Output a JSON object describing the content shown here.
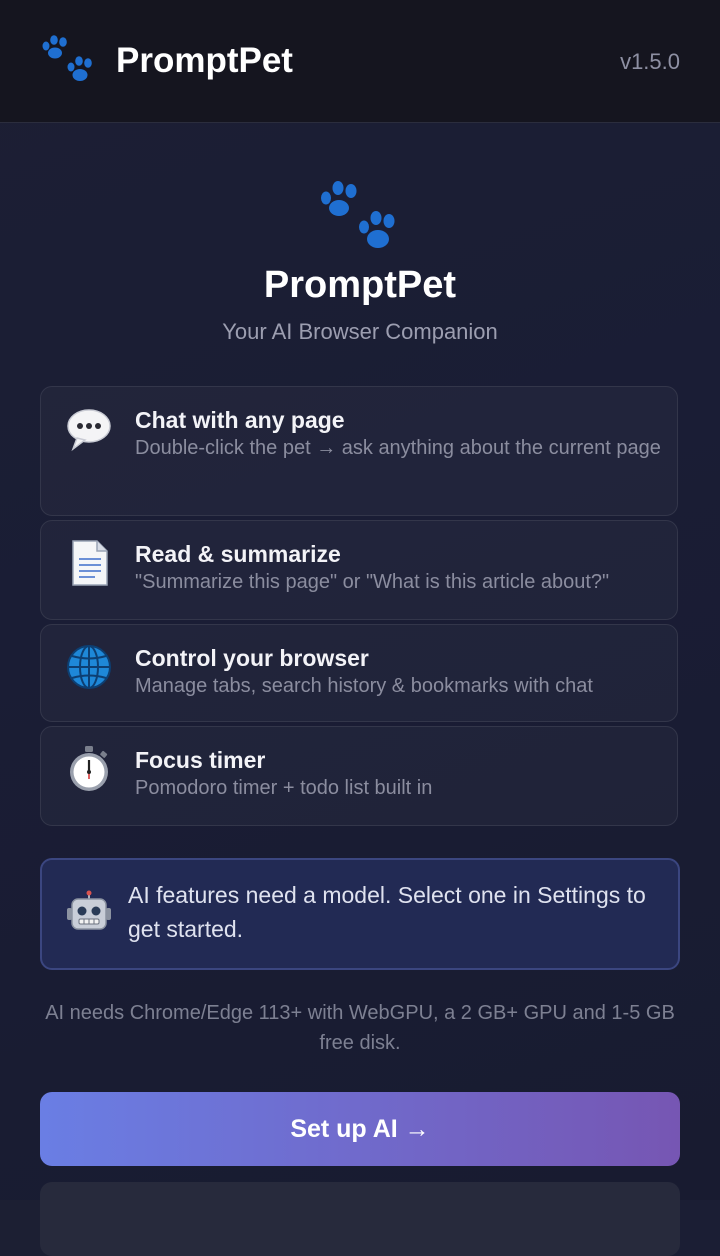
{
  "header": {
    "title": "PromptPet",
    "version": "v1.5.0",
    "logo_icon": "paw-icon"
  },
  "hero": {
    "title": "PromptPet",
    "subtitle": "Your AI Browser Companion",
    "icon": "paw-icon"
  },
  "features": [
    {
      "icon": "speech-bubble-icon",
      "title": "Chat with any page",
      "description": "Double-click the pet → ask anything about the current page"
    },
    {
      "icon": "document-icon",
      "title": "Read & summarize",
      "description": "\"Summarize this page\" or \"What is this article about?\""
    },
    {
      "icon": "globe-icon",
      "title": "Control your browser",
      "description": "Manage tabs, search history & bookmarks with chat"
    },
    {
      "icon": "stopwatch-icon",
      "title": "Focus timer",
      "description": "Pomodoro timer + todo list built in"
    }
  ],
  "notice": {
    "icon": "robot-icon",
    "text": "AI features need a model. Select one in Settings to get started."
  },
  "requirements": "AI needs Chrome/Edge 113+ with WebGPU, a 2 GB+ GPU and 1-5 GB free disk.",
  "buttons": {
    "setup_label": "Set up AI →"
  },
  "colors": {
    "accent_start": "#6a7ee4",
    "accent_end": "#7656b3",
    "paw": "#1f6fd1",
    "notice_bg": "#222a54"
  }
}
